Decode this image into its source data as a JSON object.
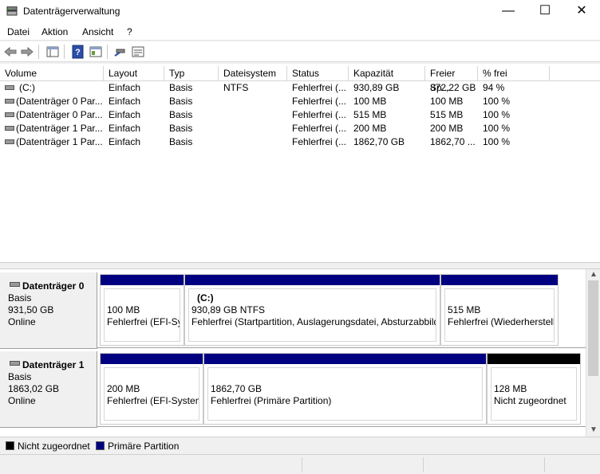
{
  "window": {
    "title": "Datenträgerverwaltung",
    "minimize": "—",
    "maximize": "☐",
    "close": "✕"
  },
  "menu": [
    "Datei",
    "Aktion",
    "Ansicht",
    "?"
  ],
  "toolbar": [
    "back-icon",
    "forward-icon",
    "console-tree-icon",
    "help-icon",
    "properties-icon",
    "connect-icon",
    "rescan-icon"
  ],
  "volumes": {
    "columns": [
      "Volume",
      "Layout",
      "Typ",
      "Dateisystem",
      "Status",
      "Kapazität",
      "Freier Sp...",
      "% frei"
    ],
    "rows": [
      [
        "(C:)",
        "Einfach",
        "Basis",
        "NTFS",
        "Fehlerfrei (...",
        "930,89 GB",
        "872,22 GB",
        "94 %"
      ],
      [
        "(Datenträger 0 Par...",
        "Einfach",
        "Basis",
        "",
        "Fehlerfrei (...",
        "100 MB",
        "100 MB",
        "100 %"
      ],
      [
        "(Datenträger 0 Par...",
        "Einfach",
        "Basis",
        "",
        "Fehlerfrei (...",
        "515 MB",
        "515 MB",
        "100 %"
      ],
      [
        "(Datenträger 1 Par...",
        "Einfach",
        "Basis",
        "",
        "Fehlerfrei (...",
        "200 MB",
        "200 MB",
        "100 %"
      ],
      [
        "(Datenträger 1 Par...",
        "Einfach",
        "Basis",
        "",
        "Fehlerfrei (...",
        "1862,70 GB",
        "1862,70 ...",
        "100 %"
      ]
    ]
  },
  "disks": [
    {
      "name": "Datenträger 0",
      "type": "Basis",
      "size": "931,50 GB",
      "state": "Online",
      "partitions": [
        {
          "label": "",
          "size": "100 MB",
          "status": "Fehlerfrei (EFI-Systempartition)",
          "kind": "primary"
        },
        {
          "label": "(C:)",
          "size": "930,89 GB NTFS",
          "status": "Fehlerfrei (Startpartition, Auslagerungsdatei, Absturzabbild, Primäre Partition)",
          "kind": "primary"
        },
        {
          "label": "",
          "size": "515 MB",
          "status": "Fehlerfrei (Wiederherstellungspartition)",
          "kind": "primary"
        }
      ]
    },
    {
      "name": "Datenträger 1",
      "type": "Basis",
      "size": "1863,02 GB",
      "state": "Online",
      "partitions": [
        {
          "label": "",
          "size": "200 MB",
          "status": "Fehlerfrei (EFI-Systempartition)",
          "kind": "primary"
        },
        {
          "label": "",
          "size": "1862,70 GB",
          "status": "Fehlerfrei (Primäre Partition)",
          "kind": "primary"
        },
        {
          "label": "",
          "size": "128 MB",
          "status": "Nicht zugeordnet",
          "kind": "unallocated"
        }
      ]
    }
  ],
  "legend": [
    {
      "label": "Nicht zugeordnet",
      "color": "#000000"
    },
    {
      "label": "Primäre Partition",
      "color": "#000080"
    }
  ],
  "scroll": {
    "up": "▲",
    "down": "▼"
  }
}
